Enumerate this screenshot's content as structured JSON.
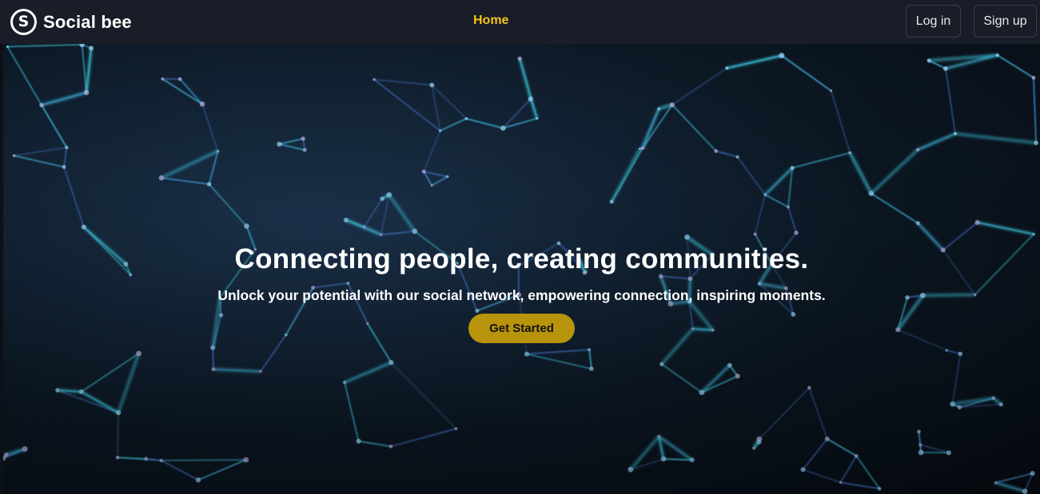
{
  "navbar": {
    "brand": {
      "logo_letter": "S",
      "name": "Social bee"
    },
    "links": [
      {
        "label": "Home",
        "active": true
      }
    ],
    "login_label": "Log in",
    "signup_label": "Sign up"
  },
  "hero": {
    "title": "Connecting people, creating communities.",
    "subtitle": "Unlock your potential with our social network, empowering connection, inspiring moments.",
    "cta_label": "Get Started",
    "background": "network-lines-image"
  },
  "colors": {
    "navbar_bg": "#191d27",
    "accent": "#f5c518",
    "cta_bg": "#b8930c",
    "hero_line": "#3fd0e8",
    "hero_line_alt": "#4a7fe0"
  }
}
